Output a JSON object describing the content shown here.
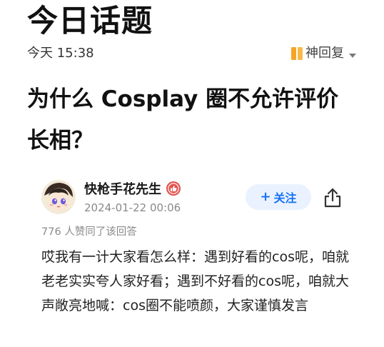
{
  "header": {
    "title": "今日话题"
  },
  "meta": {
    "date": "今天 15:38",
    "source_label": "神回复",
    "source_icon": "book-icon",
    "dropdown_icon": "caret-down-icon"
  },
  "question": {
    "title": "为什么 Cosplay 圈不允许评价长相？"
  },
  "answer": {
    "author_name": "快枪手花先生",
    "author_badge_icon": "thumb-badge-icon",
    "date": "2024-01-22 00:06",
    "follow_label": "关注",
    "follow_icon": "plus-icon",
    "share_icon": "share-icon",
    "agree_text": "776 人赞同了该回答",
    "body": "哎我有一计大家看怎么样：遇到好看的cos呢，咱就老老实实夸人家好看；遇到不好看的cos呢，咱就大声敞亮地喊：cos圈不能喷颜，大家谨慎发言"
  },
  "colors": {
    "accent_blue": "#1772f6",
    "follow_bg": "#eaf2ff",
    "source_orange": "#f5a623",
    "badge_red": "#e2524f",
    "muted_text": "#8a8a8a"
  }
}
